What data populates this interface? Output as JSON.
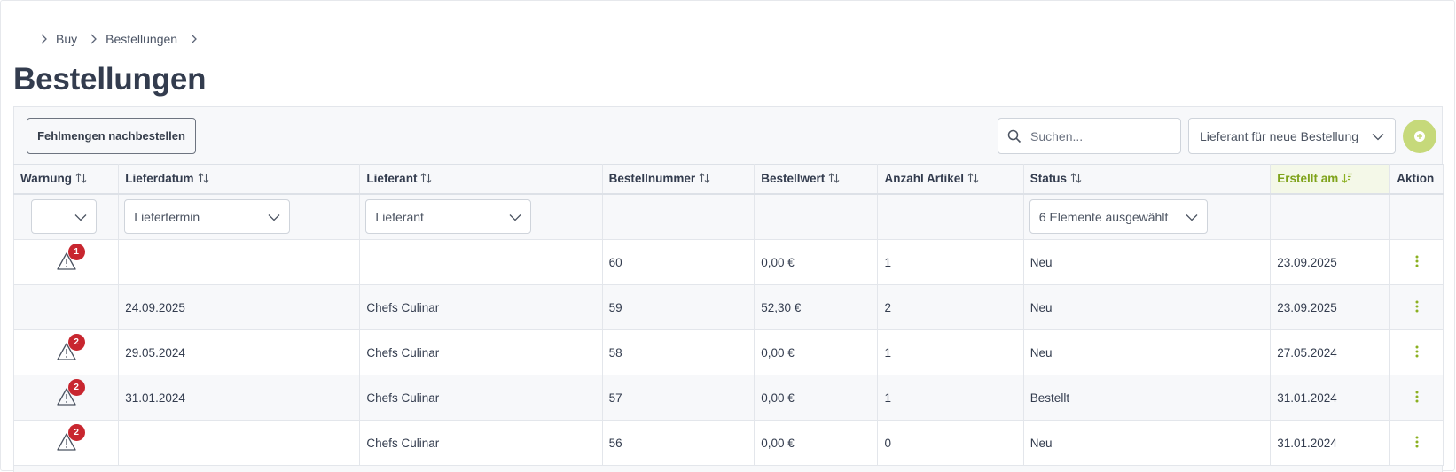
{
  "breadcrumb": {
    "items": [
      "Buy",
      "Bestellungen"
    ]
  },
  "page_title": "Bestellungen",
  "toolbar": {
    "reorder_label": "Fehlmengen nachbestellen",
    "search_placeholder": "Suchen...",
    "supplier_select_label": "Lieferant für neue Bestellung",
    "accent_color": "#c6d97a"
  },
  "columns": [
    "Warnung",
    "Lieferdatum",
    "Lieferant",
    "Bestellnummer",
    "Bestellwert",
    "Anzahl Artikel",
    "Status",
    "Erstellt am",
    "Aktion"
  ],
  "sort_active_column": "Erstellt am",
  "filters": {
    "warnung": "",
    "lieferdatum": "Liefertermin",
    "lieferant": "Lieferant",
    "status": "6 Elemente ausgewählt"
  },
  "rows": [
    {
      "warn_count": "1",
      "lieferdatum": "",
      "lieferant": "",
      "bestellnummer": "60",
      "bestellwert": "0,00 €",
      "anzahl": "1",
      "status": "Neu",
      "erstellt": "23.09.2025"
    },
    {
      "warn_count": "",
      "lieferdatum": "24.09.2025",
      "lieferant": "Chefs Culinar",
      "bestellnummer": "59",
      "bestellwert": "52,30 €",
      "anzahl": "2",
      "status": "Neu",
      "erstellt": "23.09.2025"
    },
    {
      "warn_count": "2",
      "lieferdatum": "29.05.2024",
      "lieferant": "Chefs Culinar",
      "bestellnummer": "58",
      "bestellwert": "0,00 €",
      "anzahl": "1",
      "status": "Neu",
      "erstellt": "27.05.2024"
    },
    {
      "warn_count": "2",
      "lieferdatum": "31.01.2024",
      "lieferant": "Chefs Culinar",
      "bestellnummer": "57",
      "bestellwert": "0,00 €",
      "anzahl": "1",
      "status": "Bestellt",
      "erstellt": "31.01.2024"
    },
    {
      "warn_count": "2",
      "lieferdatum": "",
      "lieferant": "Chefs Culinar",
      "bestellnummer": "56",
      "bestellwert": "0,00 €",
      "anzahl": "0",
      "status": "Neu",
      "erstellt": "31.01.2024"
    }
  ],
  "icons": {
    "breadcrumb_separator": "chevron-right-icon",
    "sort": "sort-icon",
    "warning": "warning-triangle-icon",
    "action": "kebab-menu-icon",
    "search": "search-icon",
    "dropdown": "chevron-down-icon",
    "add": "plus-circle-icon"
  }
}
